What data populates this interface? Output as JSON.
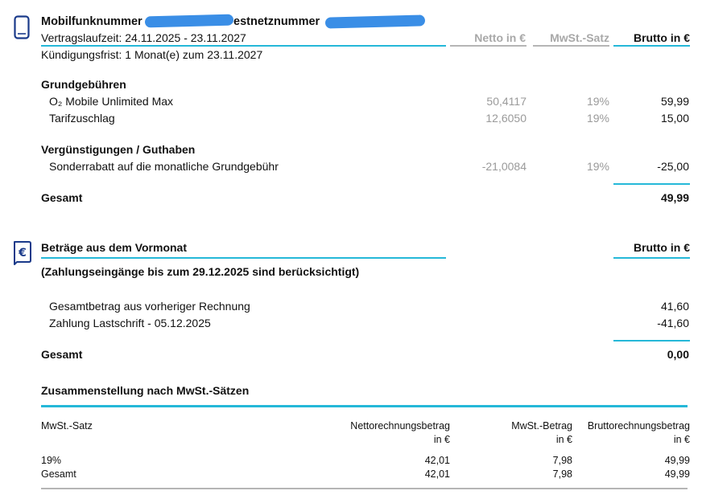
{
  "contract": {
    "title_left": "Mobilfunknummer",
    "title_right": "estnetznummer",
    "laufzeit": "Vertragslaufzeit: 24.11.2025 - 23.11.2027",
    "kuendigung": "Kündigungsfrist: 1 Monat(e) zum 23.11.2027",
    "col_netto": "Netto in €",
    "col_mwst": "MwSt.-Satz",
    "col_brutto": "Brutto in €"
  },
  "grundgebuehren": {
    "heading": "Grundgebühren",
    "rows": [
      {
        "label": "O₂ Mobile Unlimited Max",
        "netto": "50,4117",
        "mwst": "19%",
        "brutto": "59,99"
      },
      {
        "label": "Tarifzuschlag",
        "netto": "12,6050",
        "mwst": "19%",
        "brutto": "15,00"
      }
    ]
  },
  "verguenstigungen": {
    "heading": "Vergünstigungen / Guthaben",
    "rows": [
      {
        "label": "Sonderrabatt auf die monatliche Grundgebühr",
        "netto": "-21,0084",
        "mwst": "19%",
        "brutto": "-25,00"
      }
    ]
  },
  "gesamt1": {
    "label": "Gesamt",
    "value": "49,99"
  },
  "vormonat": {
    "heading": "Beträge aus dem Vormonat",
    "col_brutto": "Brutto in €",
    "subheading": "(Zahlungseingänge bis zum 29.12.2025 sind berücksichtigt)",
    "rows": [
      {
        "label": "Gesamtbetrag aus vorheriger Rechnung",
        "value": "41,60"
      },
      {
        "label": "Zahlung Lastschrift - 05.12.2025",
        "value": "-41,60"
      }
    ]
  },
  "gesamt2": {
    "label": "Gesamt",
    "value": "0,00"
  },
  "zusammenstellung": {
    "heading": "Zusammenstellung nach MwSt.-Sätzen",
    "col_satz": "MwSt.-Satz",
    "col_netto_1": "Nettorechnungsbetrag",
    "col_netto_2": "in €",
    "col_mwst_1": "MwSt.-Betrag",
    "col_mwst_2": "in €",
    "col_brutto_1": "Bruttorechnungsbetrag",
    "col_brutto_2": "in €",
    "rows": [
      {
        "satz": "19%",
        "netto": "42,01",
        "mwst": "7,98",
        "brutto": "49,99"
      },
      {
        "satz": "Gesamt",
        "netto": "42,01",
        "mwst": "7,98",
        "brutto": "49,99"
      }
    ]
  },
  "icons": {
    "phone": "mobile-phone-icon",
    "euro": "euro-document-icon",
    "accent_color": "#25b8d8",
    "icon_color": "#1a3a8a",
    "redaction_color": "#3a8ee6"
  }
}
